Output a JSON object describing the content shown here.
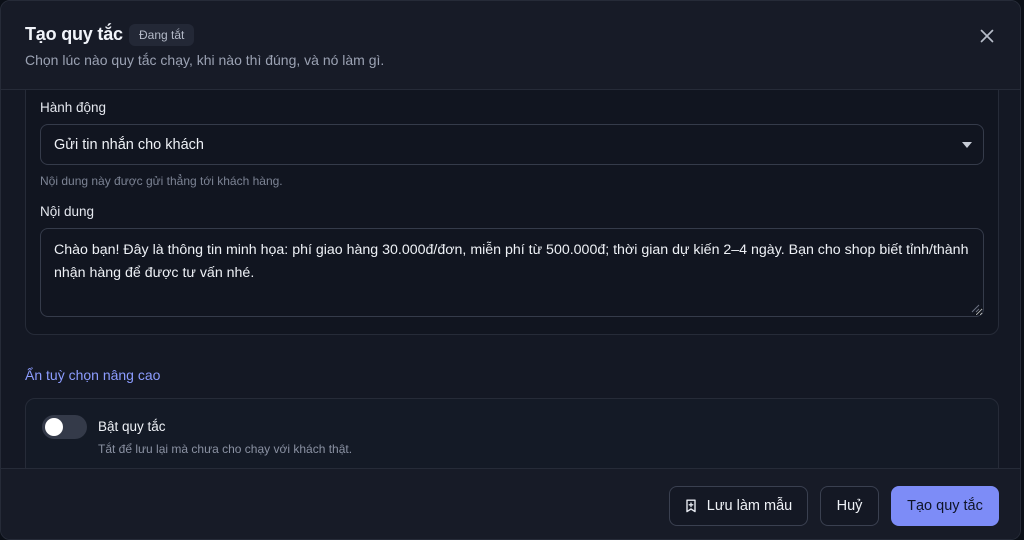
{
  "dialog": {
    "title": "Tạo quy tắc",
    "status_badge": "Đang tắt",
    "subtitle": "Chọn lúc nào quy tắc chạy, khi nào thì đúng, và nó làm gì."
  },
  "action": {
    "label": "Hành động",
    "selected": "Gửi tin nhắn cho khách",
    "hint": "Nội dung này được gửi thẳng tới khách hàng."
  },
  "content": {
    "label": "Nội dung",
    "value": "Chào bạn! Đây là thông tin minh họa: phí giao hàng 30.000đ/đơn, miễn phí từ 500.000đ; thời gian dự kiến 2–4 ngày. Bạn cho shop biết tỉnh/thành nhận hàng để được tư vấn nhé."
  },
  "advanced": {
    "toggle_link": "Ẩn tuỳ chọn nâng cao"
  },
  "enable_rule": {
    "label": "Bật quy tắc",
    "description": "Tắt để lưu lại mà chưa cho chạy với khách thật.",
    "enabled": false
  },
  "footer": {
    "save_template_label": "Lưu làm mẫu",
    "cancel_label": "Huỷ",
    "create_label": "Tạo quy tắc"
  },
  "icons": {
    "close": "close-icon",
    "bookmark": "bookmark-icon",
    "dropdown": "chevron-down-icon"
  },
  "colors": {
    "accent": "#7d8cf7",
    "link": "#8c9cff",
    "background": "#141824"
  }
}
